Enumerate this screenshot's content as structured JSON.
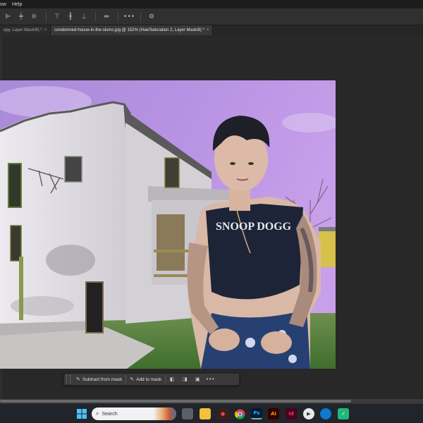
{
  "menubar": {
    "items": [
      "ow",
      "Help"
    ]
  },
  "optionsbar": {
    "align_icons": [
      "align-left-icon",
      "align-hcenter-icon",
      "align-right-icon",
      "align-top-icon",
      "align-vcenter-icon",
      "align-bottom-icon",
      "distribute-icon"
    ],
    "more_label": "•••",
    "settings_icon": "gear-icon"
  },
  "tabs": [
    {
      "label": "opy, Layer Mask/8) *",
      "close": "×",
      "active": false
    },
    {
      "label": "condemned-house-in-the-slums.jpg @ 152% (Hue/Saturation 2, Layer Mask/8) *",
      "close": "×",
      "active": true
    }
  ],
  "context_bar": {
    "subtract_label": "Subtract from mask",
    "add_label": "Add to mask",
    "more_label": "•••"
  },
  "taskbar": {
    "search_placeholder": "Search",
    "apps": [
      "windows-start",
      "search",
      "widgets",
      "file-explorer",
      "app-red",
      "chrome",
      "photoshop",
      "illustrator",
      "indesign",
      "media-player",
      "edge",
      "shield-app"
    ],
    "labels": {
      "ps": "Ps",
      "ai": "Ai",
      "id": "Id"
    }
  },
  "photo": {
    "shirt_text": "SNOOP DOGG",
    "colors": {
      "sky": "#b38be0",
      "house": "#d9d6dc",
      "grass": "#4d8a3a"
    }
  }
}
